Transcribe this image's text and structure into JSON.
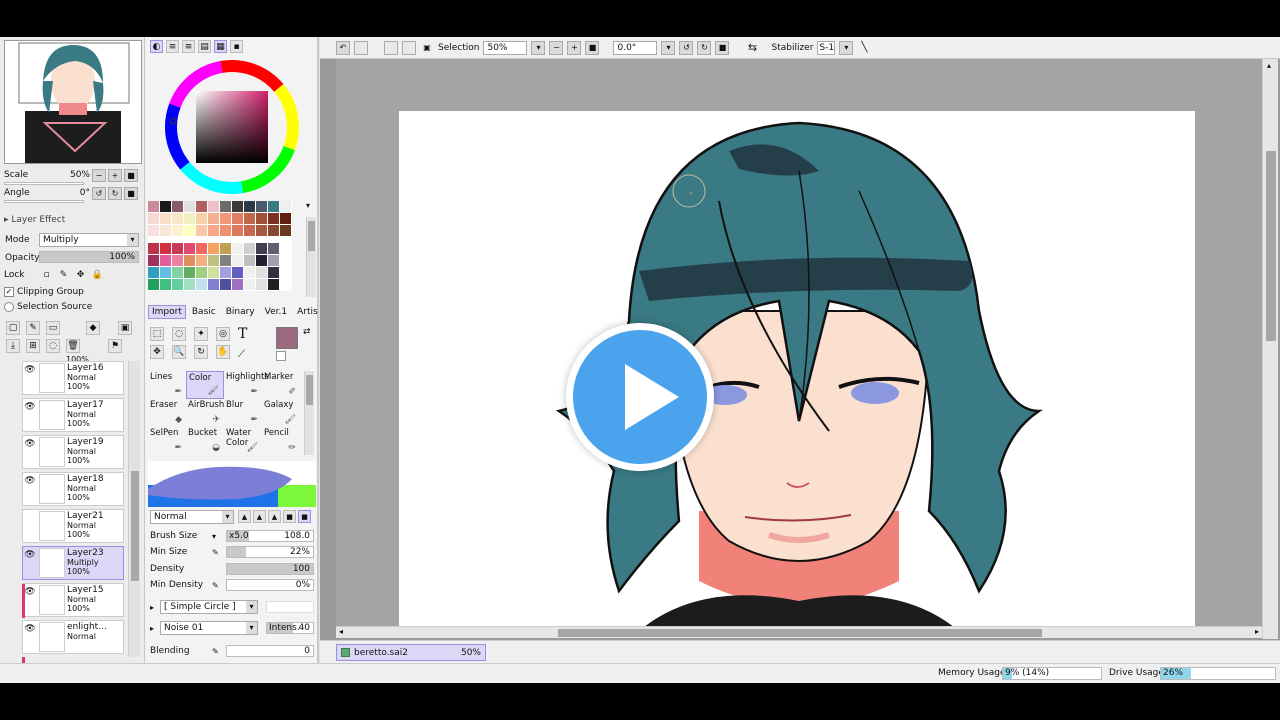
{
  "navigator": {
    "scale_label": "Scale",
    "scale_value": "50%",
    "angle_label": "Angle",
    "angle_value": "0°"
  },
  "layer_effect": {
    "header": "Layer Effect",
    "mode_label": "Mode",
    "mode_value": "Multiply",
    "opacity_label": "Opacity",
    "opacity_value": "100%",
    "opacity_fraction": 1.0,
    "lock_label": "Lock",
    "clipping_group": "Clipping Group",
    "selection_source": "Selection Source"
  },
  "layers": {
    "top_partial": "100%",
    "items": [
      {
        "name": "Layer16",
        "mode": "Normal",
        "opacity": "100%"
      },
      {
        "name": "Layer17",
        "mode": "Normal",
        "opacity": "100%"
      },
      {
        "name": "Layer19",
        "mode": "Normal",
        "opacity": "100%"
      },
      {
        "name": "Layer18",
        "mode": "Normal",
        "opacity": "100%"
      },
      {
        "name": "Layer21",
        "mode": "Normal",
        "opacity": "100%"
      },
      {
        "name": "Layer23",
        "mode": "Multiply",
        "opacity": "100%"
      },
      {
        "name": "Layer15",
        "mode": "Normal",
        "opacity": "100%"
      },
      {
        "name": "enlight...",
        "mode": "Normal",
        "opacity": ""
      }
    ]
  },
  "brush_tabs": [
    "Import",
    "Basic",
    "Binary",
    "Ver.1",
    "Artistic"
  ],
  "brushes": [
    {
      "name": "Lines",
      "icon": "pen-icon"
    },
    {
      "name": "Color",
      "icon": "brush-icon"
    },
    {
      "name": "Highlights",
      "icon": "pen-icon"
    },
    {
      "name": "Marker",
      "icon": "marker-icon"
    },
    {
      "name": "Eraser",
      "icon": "eraser-icon"
    },
    {
      "name": "AirBrush",
      "icon": "airbrush-icon"
    },
    {
      "name": "Blur",
      "icon": "blur-icon"
    },
    {
      "name": "Galaxy",
      "icon": "brush-icon"
    },
    {
      "name": "SelPen",
      "icon": "pen-icon"
    },
    {
      "name": "Bucket",
      "icon": "bucket-icon"
    },
    {
      "name": "Water Color",
      "icon": "brush-icon"
    },
    {
      "name": "Pencil",
      "icon": "pencil-icon"
    }
  ],
  "brush_props": {
    "blend_mode": "Normal",
    "brush_size_label": "Brush Size",
    "brush_size_mult": "x5.0",
    "brush_size_value": "108.0",
    "min_size_label": "Min Size",
    "min_size_value": "22%",
    "min_size_fraction": 0.22,
    "density_label": "Density",
    "density_value": "100",
    "density_fraction": 1.0,
    "min_density_label": "Min Density",
    "min_density_value": "0%",
    "shape": "[ Simple Circle ]",
    "texture": "Noise 01",
    "intens_label": "Intens.",
    "intens_value": "40",
    "blending_label": "Blending",
    "blending_value": "0"
  },
  "toolbar": {
    "selection_label": "Selection",
    "zoom_value": "50%",
    "rotation_value": "0.0°",
    "stabilizer_label": "Stabilizer",
    "stabilizer_value": "S-1"
  },
  "document": {
    "filename": "beretto.sai2",
    "zoom": "50%"
  },
  "status": {
    "memory_label": "Memory Usage",
    "memory_value": "9%",
    "memory_detail": "(14%)",
    "memory_fraction": 0.09,
    "drive_label": "Drive Usage",
    "drive_value": "26%",
    "drive_fraction": 0.26
  },
  "colors": {
    "accent": "#dcd6f7",
    "accent_border": "#9b8fe0",
    "selected_color": "#9b6a80",
    "play_button": "#4aa3ec",
    "hair": "#3a7a84",
    "hair_shadow": "#243f4a",
    "skin": "#fbe0cf"
  }
}
